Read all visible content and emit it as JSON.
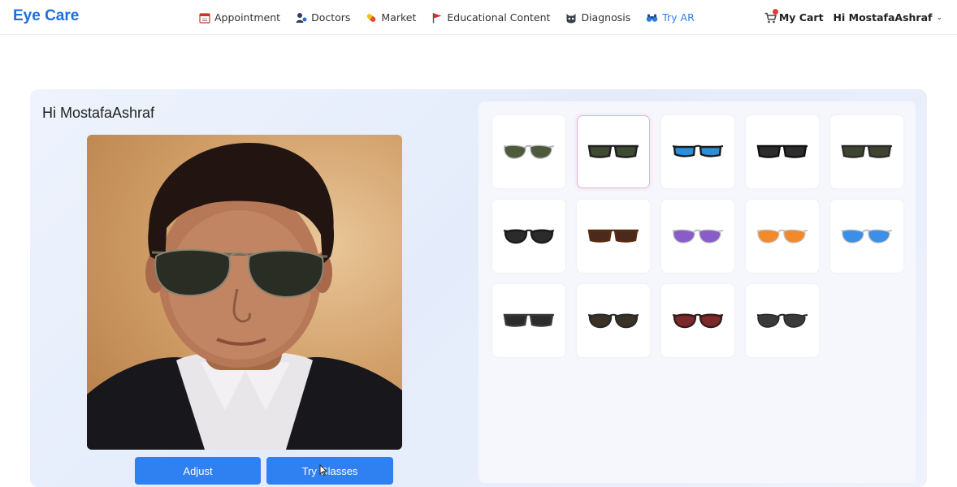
{
  "brand": "Eye Care",
  "nav": [
    {
      "label": "Appointment",
      "icon": "calendar-icon"
    },
    {
      "label": "Doctors",
      "icon": "doctor-icon"
    },
    {
      "label": "Market",
      "icon": "pill-icon"
    },
    {
      "label": "Educational Content",
      "icon": "flag-icon"
    },
    {
      "label": "Diagnosis",
      "icon": "cat-mask-icon"
    },
    {
      "label": "Try AR",
      "icon": "binoculars-icon",
      "active": true
    }
  ],
  "cart": {
    "label": "My Cart",
    "icon": "cart-icon"
  },
  "user": {
    "label": "Hi MostafaAshraf",
    "icon": "chevron-down-icon"
  },
  "main": {
    "greeting": "Hi MostafaAshraf",
    "buttons": {
      "adjust": "Adjust",
      "try": "Try Glasses"
    }
  },
  "colors": {
    "accent": "#2f80f0",
    "brand": "#1b6fe0",
    "active_nav": "#2f7fe0",
    "selected_border": "#e7b6cf"
  },
  "glasses": [
    {
      "style": "aviator",
      "lens": "#4d5b3c",
      "frame": "#b8b8b8"
    },
    {
      "style": "wayfarer",
      "lens": "#3f4a33",
      "frame": "#1f1f1f",
      "selected": true
    },
    {
      "style": "wrap",
      "lens": "#2a8fd8",
      "frame": "#1b1b1b"
    },
    {
      "style": "wayfarer",
      "lens": "#2c2c2c",
      "frame": "#111111"
    },
    {
      "style": "wayfarer",
      "lens": "#3d4530",
      "frame": "#2a2a2a"
    },
    {
      "style": "round",
      "lens": "#2b2b2b",
      "frame": "#1a1a1a"
    },
    {
      "style": "wayfarer",
      "lens": "#4a2a1a",
      "frame": "#5a2c12"
    },
    {
      "style": "aviator",
      "lens": "#8a5cc8",
      "frame": "#bdbdbd"
    },
    {
      "style": "aviator",
      "lens": "#f08a2a",
      "frame": "#c8c8c8"
    },
    {
      "style": "aviator",
      "lens": "#3b8fe8",
      "frame": "#c0c0c0"
    },
    {
      "style": "wayfarer",
      "lens": "#2c2c2c",
      "frame": "#3a3a3a"
    },
    {
      "style": "round",
      "lens": "#3a3225",
      "frame": "#2a2a2a"
    },
    {
      "style": "round",
      "lens": "#7a2a2a",
      "frame": "#3a1a1a"
    },
    {
      "style": "aviator",
      "lens": "#3a3a3a",
      "frame": "#222222"
    }
  ]
}
